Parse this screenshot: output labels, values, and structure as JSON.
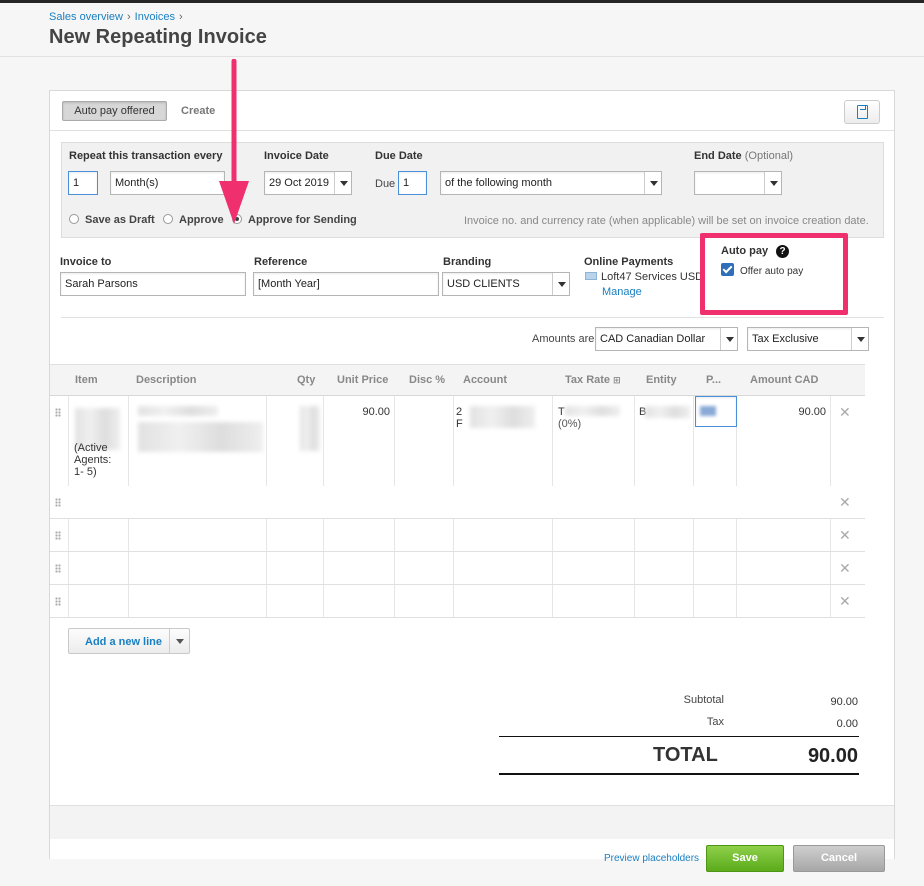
{
  "breadcrumb": {
    "items": [
      "Sales overview",
      "Invoices"
    ],
    "separator": "›"
  },
  "page_title": "New Repeating Invoice",
  "tabs": {
    "active": "Auto pay offered",
    "other": "Create"
  },
  "repeat": {
    "repeat_label": "Repeat this transaction every",
    "repeat_count": "1",
    "repeat_unit": "Month(s)",
    "invoice_date_label": "Invoice Date",
    "invoice_date": "29 Oct 2019",
    "due_date_label": "Due Date",
    "due_prefix": "Due",
    "due_value": "1",
    "due_term": "of the following month",
    "end_date_label": "End Date",
    "end_date_optional": "(Optional)",
    "end_date_value": "",
    "options": [
      "Save as Draft",
      "Approve",
      "Approve for Sending"
    ],
    "selected_option": "Approve for Sending",
    "note": "Invoice no. and currency rate (when applicable) will be set on invoice creation date."
  },
  "invoice": {
    "invoice_to_label": "Invoice to",
    "invoice_to": "Sarah Parsons",
    "reference_label": "Reference",
    "reference": "[Month Year]",
    "branding_label": "Branding",
    "branding": "USD CLIENTS",
    "online_payments_label": "Online Payments",
    "online_payments_service": "Loft47 Services USD",
    "manage_link": "Manage",
    "auto_pay_label": "Auto pay",
    "auto_pay_help": "?",
    "offer_auto_pay": "Offer auto pay",
    "offer_auto_pay_checked": true
  },
  "amounts": {
    "label": "Amounts are:",
    "currency": "CAD Canadian Dollar",
    "tax_mode": "Tax Exclusive"
  },
  "table": {
    "headers": [
      "Item",
      "Description",
      "Qty",
      "Unit Price",
      "Disc %",
      "Account",
      "Tax Rate",
      "Entity",
      "P...",
      "Amount CAD"
    ],
    "tax_rate_icon": "⊞",
    "rows": [
      {
        "item": "(Active Agents: 1- 5)",
        "unit_price": "90.00",
        "account": "2",
        "account2": "F",
        "tax_rate": "T",
        "tax_rate_pct": "(0%)",
        "entity": "B",
        "amount": "90.00"
      },
      {
        "item": "",
        "unit_price": "",
        "amount": ""
      },
      {
        "item": "",
        "unit_price": "",
        "amount": ""
      },
      {
        "item": "",
        "unit_price": "",
        "amount": ""
      },
      {
        "item": "",
        "unit_price": "",
        "amount": ""
      }
    ],
    "remove_glyph": "✕"
  },
  "add_line_label": "Add a new line",
  "totals": {
    "subtotal_label": "Subtotal",
    "subtotal": "90.00",
    "tax_label": "Tax",
    "tax": "0.00",
    "total_label": "TOTAL",
    "total": "90.00"
  },
  "footer": {
    "preview_placeholders": "Preview placeholders",
    "save": "Save",
    "cancel": "Cancel"
  },
  "colors": {
    "accent": "#1a7fc1",
    "highlight": "#f0306e",
    "save": "#5bab1b"
  }
}
